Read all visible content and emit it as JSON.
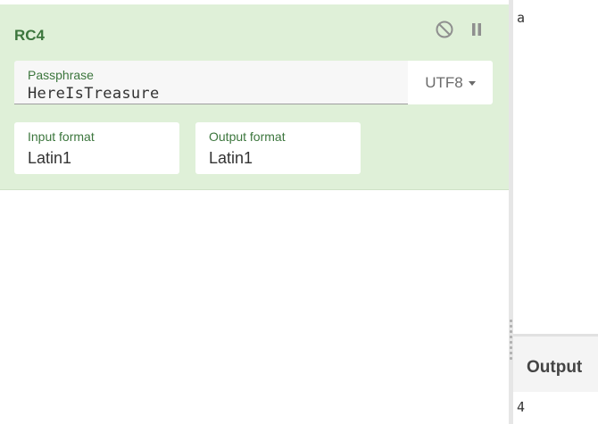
{
  "operation": {
    "title": "RC4",
    "disable_icon": "disable-icon",
    "pause_icon": "pause-icon",
    "passphrase": {
      "label": "Passphrase",
      "value": "HereIsTreasure",
      "encoding": "UTF8"
    },
    "input_format": {
      "label": "Input format",
      "value": "Latin1"
    },
    "output_format": {
      "label": "Output format",
      "value": "Latin1"
    }
  },
  "input_panel": {
    "text": "a"
  },
  "output_panel": {
    "title": "Output",
    "text": "4"
  },
  "colors": {
    "card_bg": "#dff0d8",
    "label_green": "#3c763d"
  }
}
